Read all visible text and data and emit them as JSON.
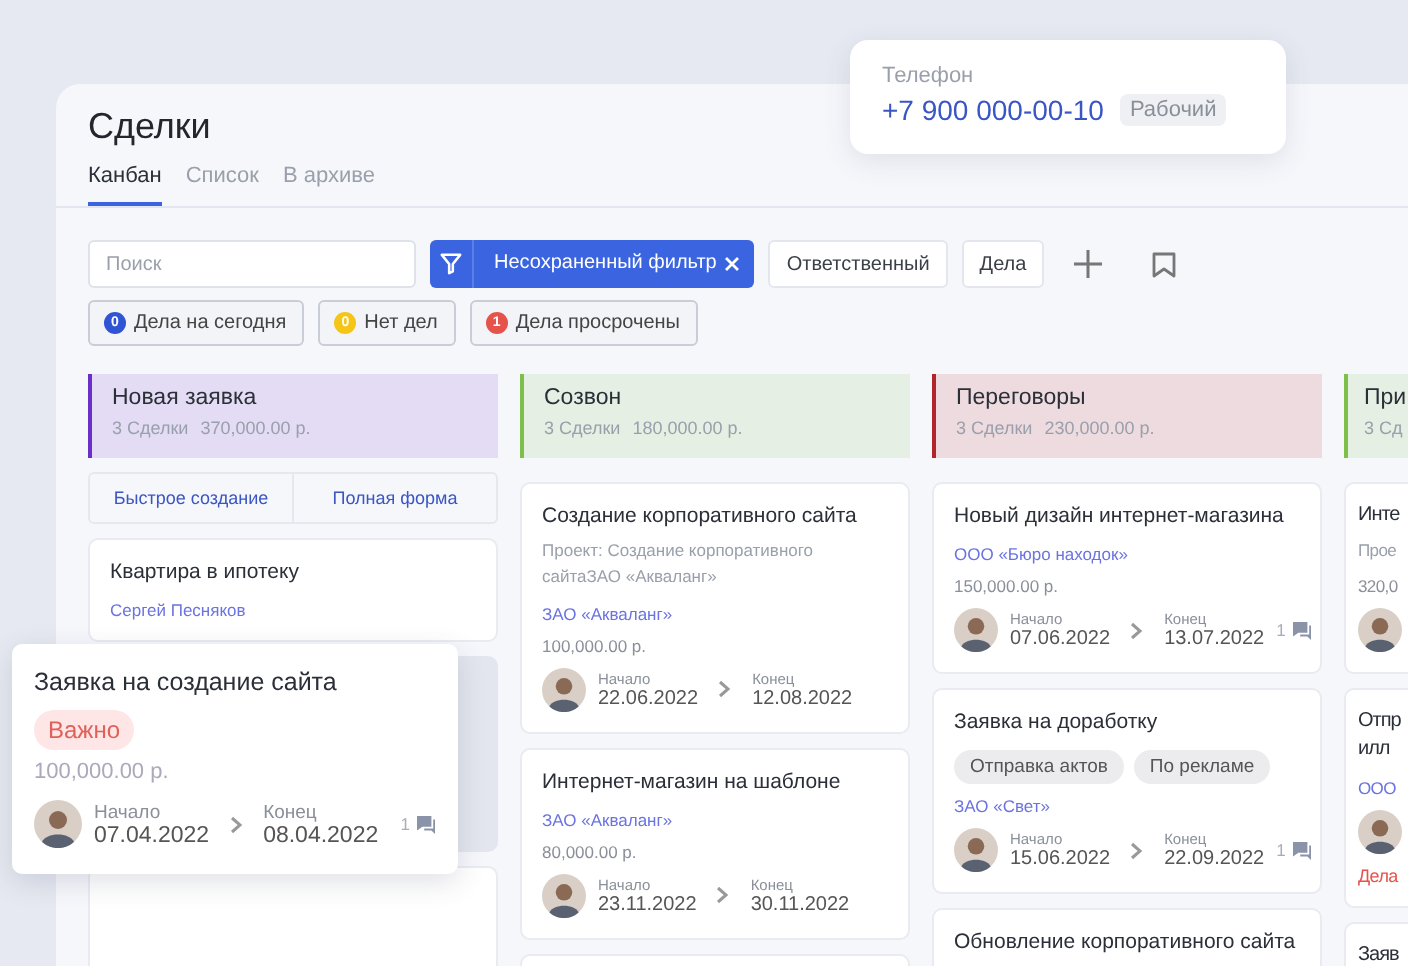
{
  "page": {
    "title": "Сделки"
  },
  "tabs": [
    {
      "label": "Канбан",
      "selected": true
    },
    {
      "label": "Список",
      "selected": false
    },
    {
      "label": "В архиве",
      "selected": false
    }
  ],
  "phone_popup": {
    "label": "Телефон",
    "number": "+7 900 000-00-10",
    "type": "Рабочий"
  },
  "toolbar": {
    "search_placeholder": "Поиск",
    "filter": "Несохраненный фильтр",
    "buttons": [
      "Ответственный",
      "Дела"
    ]
  },
  "quick_filters": [
    {
      "count": "0",
      "label": "Дела на сегодня",
      "color": "#2f55d4"
    },
    {
      "count": "0",
      "label": "Нет дел",
      "color": "#f5c518"
    },
    {
      "count": "1",
      "label": "Дела просрочены",
      "color": "#e5534b"
    }
  ],
  "columns": [
    {
      "title": "Новая заявка",
      "count": "3 Сделки",
      "sum": "370,000.00 р.",
      "color": "#6b2fc9",
      "items": [
        {
          "kind": "quick_create",
          "buttons": [
            "Быстрое создание",
            "Полная форма"
          ]
        },
        {
          "kind": "deal",
          "title": "Квартира в ипотеку",
          "company": "Сергей Песняков"
        },
        {
          "kind": "placeholder"
        },
        {
          "kind": "deal"
        }
      ]
    },
    {
      "title": "Созвон",
      "count": "3 Сделки",
      "sum": "180,000.00 р.",
      "color": "#7cbf4a",
      "items": [
        {
          "kind": "deal",
          "title": "Создание корпоративного сайта",
          "project": "Проект: Создание корпоративного сайтаЗАО «Акваланг»",
          "company": "ЗАО «Акваланг»",
          "amount": "100,000.00 р.",
          "start_label": "Начало",
          "start": "22.06.2022",
          "end_label": "Конец",
          "end": "12.08.2022"
        },
        {
          "kind": "deal",
          "title": "Интернет-магазин на шаблоне",
          "company": "ЗАО «Акваланг»",
          "amount": "80,000.00 р.",
          "start_label": "Начало",
          "start": "23.11.2022",
          "end_label": "Конец",
          "end": "30.11.2022"
        },
        {
          "kind": "deal"
        }
      ]
    },
    {
      "title": "Переговоры",
      "count": "3 Сделки",
      "sum": "230,000.00 р.",
      "color": "#b3242c",
      "items": [
        {
          "kind": "deal",
          "title": "Новый дизайн интернет-магазина",
          "company": "ООО «Бюро находок»",
          "amount": "150,000.00 р.",
          "start_label": "Начало",
          "start": "07.06.2022",
          "end_label": "Конец",
          "end": "13.07.2022",
          "comments": "1"
        },
        {
          "kind": "deal",
          "title": "Заявка на доработку",
          "tags": [
            "Отправка актов",
            "По рекламе"
          ],
          "company": "ЗАО «Свет»",
          "start_label": "Начало",
          "start": "15.06.2022",
          "end_label": "Конец",
          "end": "22.09.2022",
          "comments": "1"
        },
        {
          "kind": "deal",
          "title": "Обновление корпоративного сайта"
        }
      ]
    },
    {
      "title": "При",
      "count": "3 Сд",
      "color": "#7cbf4a",
      "items": [
        {
          "kind": "deal",
          "title": "Инте",
          "project": "Прое",
          "amount": "320,0",
          "avatar_only": true
        },
        {
          "kind": "deal",
          "title": "Отпр\nилл",
          "company": "ООО",
          "avatar_only": true,
          "overdue": "Дела"
        },
        {
          "kind": "deal",
          "title": "Заяв"
        }
      ]
    }
  ],
  "dragged_card": {
    "title": "Заявка на создание сайта",
    "tags": [
      "Важно"
    ],
    "amount": "100,000.00 р.",
    "start_label": "Начало",
    "start": "07.04.2022",
    "end_label": "Конец",
    "end": "08.04.2022",
    "comments": "1"
  }
}
